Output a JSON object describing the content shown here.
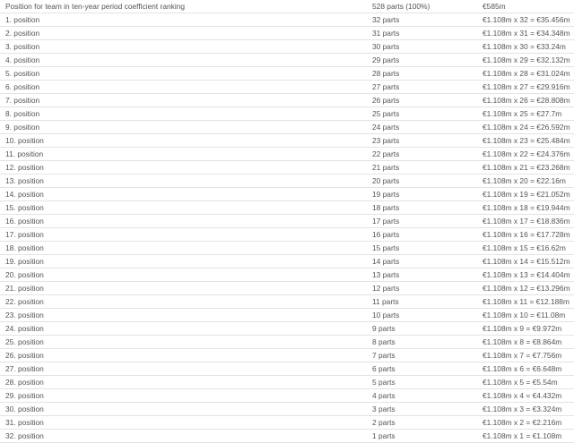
{
  "table": {
    "header": {
      "position": "Position for team in ten-year period coefficient ranking",
      "parts": "528 parts (100%)",
      "amount": "€585m"
    },
    "rows": [
      {
        "position": "1. position",
        "parts": "32 parts",
        "amount": "€1.108m x 32 = €35.456m"
      },
      {
        "position": "2. position",
        "parts": "31 parts",
        "amount": "€1.108m x 31 = €34.348m"
      },
      {
        "position": "3. position",
        "parts": "30 parts",
        "amount": "€1.108m x 30 = €33.24m"
      },
      {
        "position": "4. position",
        "parts": "29 parts",
        "amount": "€1.108m x 29 = €32.132m"
      },
      {
        "position": "5. position",
        "parts": "28 parts",
        "amount": "€1.108m x 28 = €31.024m"
      },
      {
        "position": "6. position",
        "parts": "27 parts",
        "amount": "€1.108m x 27 = €29.916m"
      },
      {
        "position": "7. position",
        "parts": "26 parts",
        "amount": "€1.108m x 26 = €28.808m"
      },
      {
        "position": "8. position",
        "parts": "25 parts",
        "amount": "€1.108m x 25 = €27.7m"
      },
      {
        "position": "9. position",
        "parts": "24 parts",
        "amount": "€1.108m x 24 = €26.592m"
      },
      {
        "position": "10. position",
        "parts": "23 parts",
        "amount": "€1.108m x 23 = €25.484m"
      },
      {
        "position": "11. position",
        "parts": "22 parts",
        "amount": "€1.108m x 22 = €24.376m"
      },
      {
        "position": "12. position",
        "parts": "21 parts",
        "amount": "€1.108m x 21 = €23.268m"
      },
      {
        "position": "13. position",
        "parts": "20 parts",
        "amount": "€1.108m x 20 = €22.16m"
      },
      {
        "position": "14. position",
        "parts": "19 parts",
        "amount": "€1.108m x 19 = €21.052m"
      },
      {
        "position": "15. position",
        "parts": "18 parts",
        "amount": "€1.108m x 18 = €19.944m"
      },
      {
        "position": "16. position",
        "parts": "17 parts",
        "amount": "€1.108m x 17 = €18.836m"
      },
      {
        "position": "17. position",
        "parts": "16 parts",
        "amount": "€1.108m x 16 = €17.728m"
      },
      {
        "position": "18. position",
        "parts": "15 parts",
        "amount": "€1.108m x 15 = €16.62m"
      },
      {
        "position": "19. position",
        "parts": "14 parts",
        "amount": "€1.108m x 14 = €15.512m"
      },
      {
        "position": "20. position",
        "parts": "13 parts",
        "amount": "€1.108m x 13 = €14.404m"
      },
      {
        "position": "21. position",
        "parts": "12 parts",
        "amount": "€1.108m x 12 = €13.296m"
      },
      {
        "position": "22. position",
        "parts": "11 parts",
        "amount": "€1.108m x 11 = €12.188m"
      },
      {
        "position": "23. position",
        "parts": "10 parts",
        "amount": "€1.108m x 10 = €11.08m"
      },
      {
        "position": "24. position",
        "parts": "9 parts",
        "amount": "€1.108m x 9 = €9.972m"
      },
      {
        "position": "25. position",
        "parts": "8 parts",
        "amount": "€1.108m x 8 = €8.864m"
      },
      {
        "position": "26. position",
        "parts": "7 parts",
        "amount": "€1.108m x 7 = €7.756m"
      },
      {
        "position": "27. position",
        "parts": "6 parts",
        "amount": "€1.108m x 6 = €6.648m"
      },
      {
        "position": "28. position",
        "parts": "5 parts",
        "amount": "€1.108m x 5 = €5.54m"
      },
      {
        "position": "29. position",
        "parts": "4 parts",
        "amount": "€1.108m x 4 = €4.432m"
      },
      {
        "position": "30. position",
        "parts": "3 parts",
        "amount": "€1.108m x 3 = €3.324m"
      },
      {
        "position": "31. position",
        "parts": "2 parts",
        "amount": "€1.108m x 2 = €2.216m"
      },
      {
        "position": "32. position",
        "parts": "1 parts",
        "amount": "€1.108m x 1 = €1.108m"
      }
    ]
  }
}
